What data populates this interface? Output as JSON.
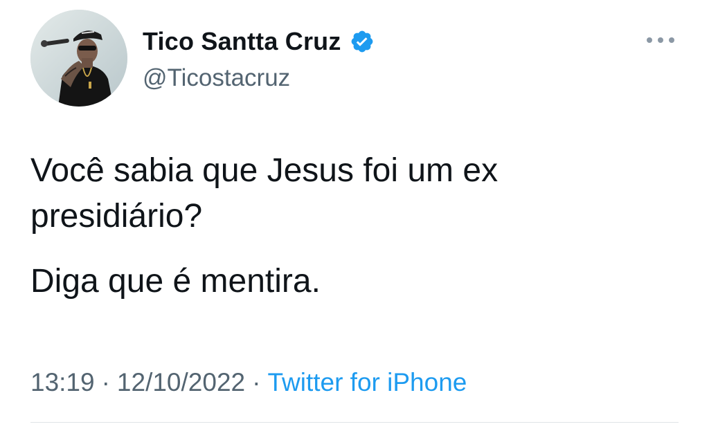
{
  "author": {
    "display_name": "Tico Santta Cruz",
    "handle": "@Ticostacruz",
    "verified": true,
    "avatar_icon": "profile-photo-singer-with-microphone"
  },
  "tweet": {
    "paragraphs": [
      "Você sabia que Jesus foi um ex presidiário?",
      "Diga que é mentira."
    ]
  },
  "meta": {
    "time": "13:19",
    "separator": "·",
    "date": "12/10/2022",
    "source": "Twitter for iPhone"
  },
  "colors": {
    "text": "#0f1419",
    "secondary": "#536471",
    "accent": "#1d9bf0",
    "divider": "#dfe3e6"
  },
  "icons": {
    "verified": "verified-badge-icon",
    "more": "more-options-icon"
  }
}
